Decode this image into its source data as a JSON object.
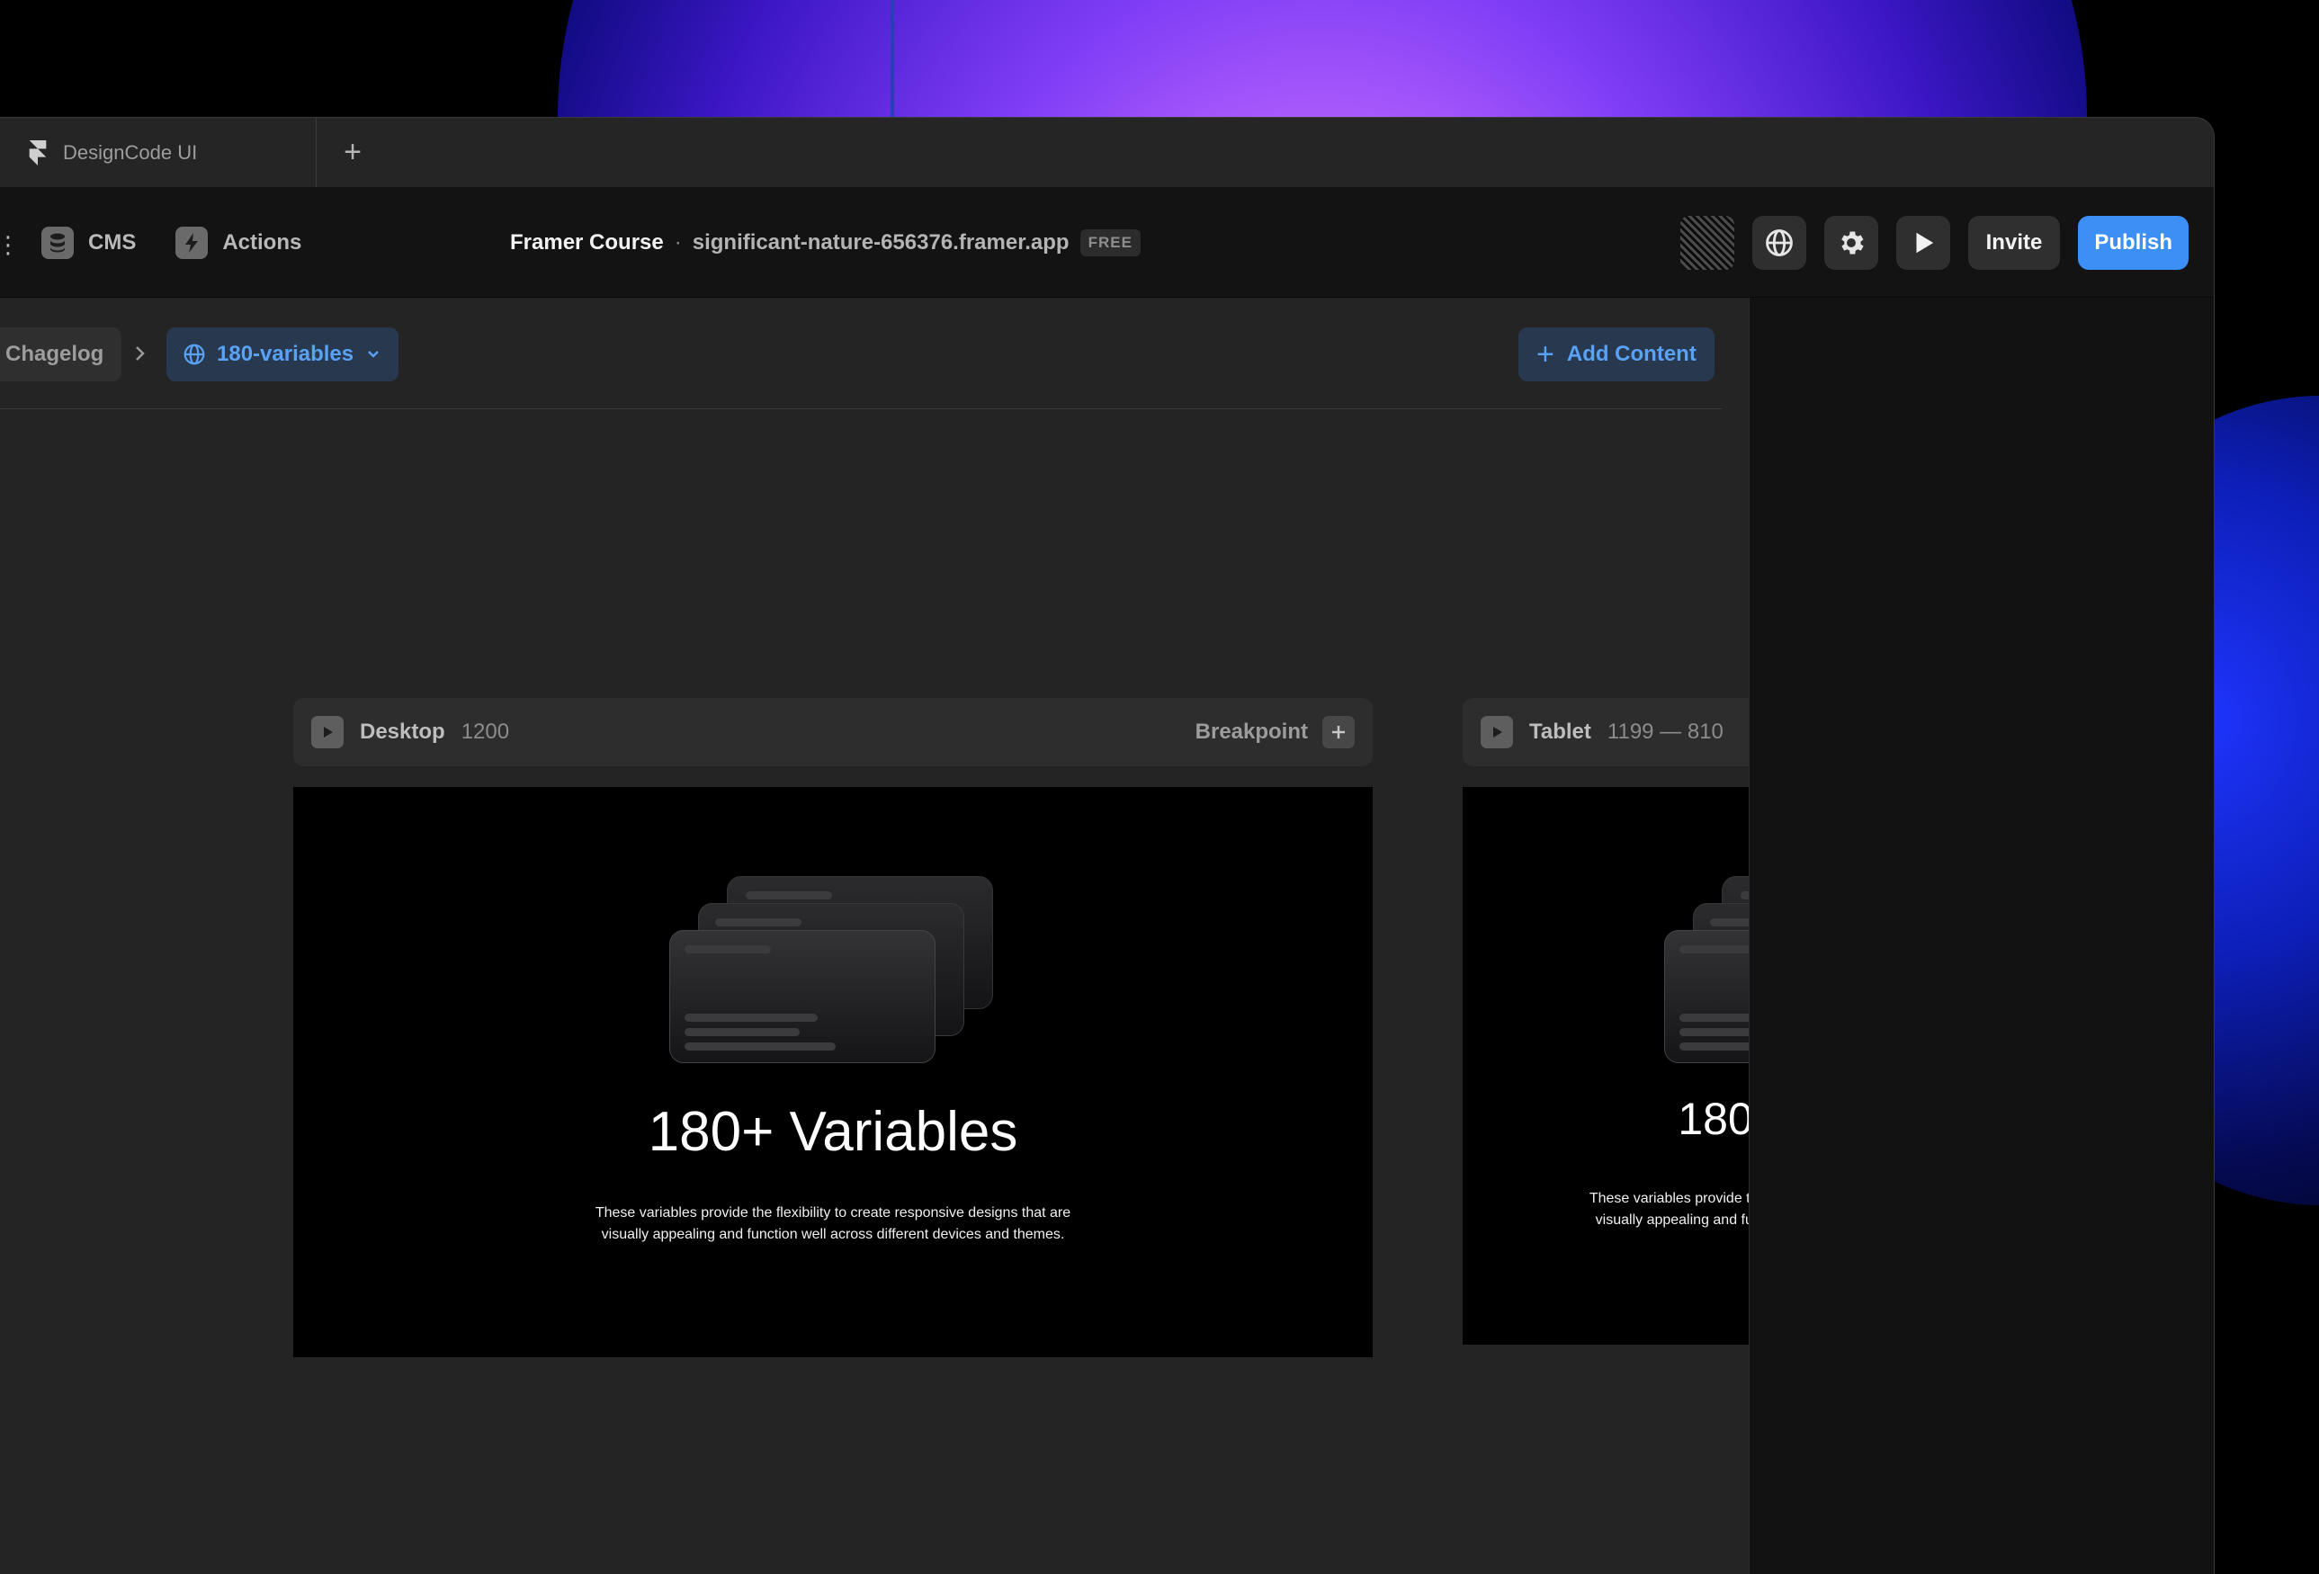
{
  "tab": {
    "label": "DesignCode UI"
  },
  "toolbar": {
    "cms_label": "CMS",
    "actions_label": "Actions",
    "project_title": "Framer Course",
    "separator": "·",
    "project_url": "significant-nature-656376.framer.app",
    "plan_badge": "FREE",
    "invite_label": "Invite",
    "publish_label": "Publish"
  },
  "breadcrumb": {
    "previous": "Chagelog",
    "current": "180-variables"
  },
  "add_content_label": "Add Content",
  "frames": [
    {
      "name": "Desktop",
      "size": "1200",
      "breakpoint_label": "Breakpoint"
    },
    {
      "name": "Tablet",
      "size": "1199 — 810"
    }
  ],
  "preview": {
    "title": "180+ Variables",
    "description": "These variables provide the flexibility to create responsive designs that are visually appealing and function well across different devices and themes."
  },
  "colors": {
    "accent": "#3b8ff5",
    "accent_text": "#59a2f5",
    "canvas": "#242424",
    "toolbar": "#131313"
  }
}
